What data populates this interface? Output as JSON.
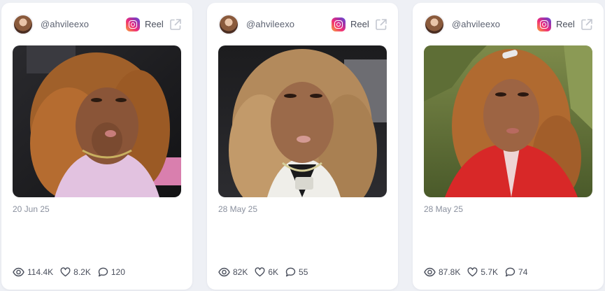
{
  "cards": [
    {
      "username": "@ahvileexo",
      "type_label": "Reel",
      "date": "20 Jun 25",
      "views": "114.4K",
      "likes": "8.2K",
      "comments": "120"
    },
    {
      "username": "@ahvileexo",
      "type_label": "Reel",
      "date": "28 May 25",
      "views": "82K",
      "likes": "6K",
      "comments": "55"
    },
    {
      "username": "@ahvileexo",
      "type_label": "Reel",
      "date": "28 May 25",
      "views": "87.8K",
      "likes": "5.7K",
      "comments": "74"
    }
  ],
  "icons": {
    "platform": "instagram-icon",
    "open": "external-link-icon",
    "views": "eye-icon",
    "likes": "heart-icon",
    "comments": "comment-icon"
  },
  "colors": {
    "background": "#eef0f5",
    "card": "#ffffff",
    "text_muted": "#8a909e",
    "text": "#4a4f5c"
  }
}
